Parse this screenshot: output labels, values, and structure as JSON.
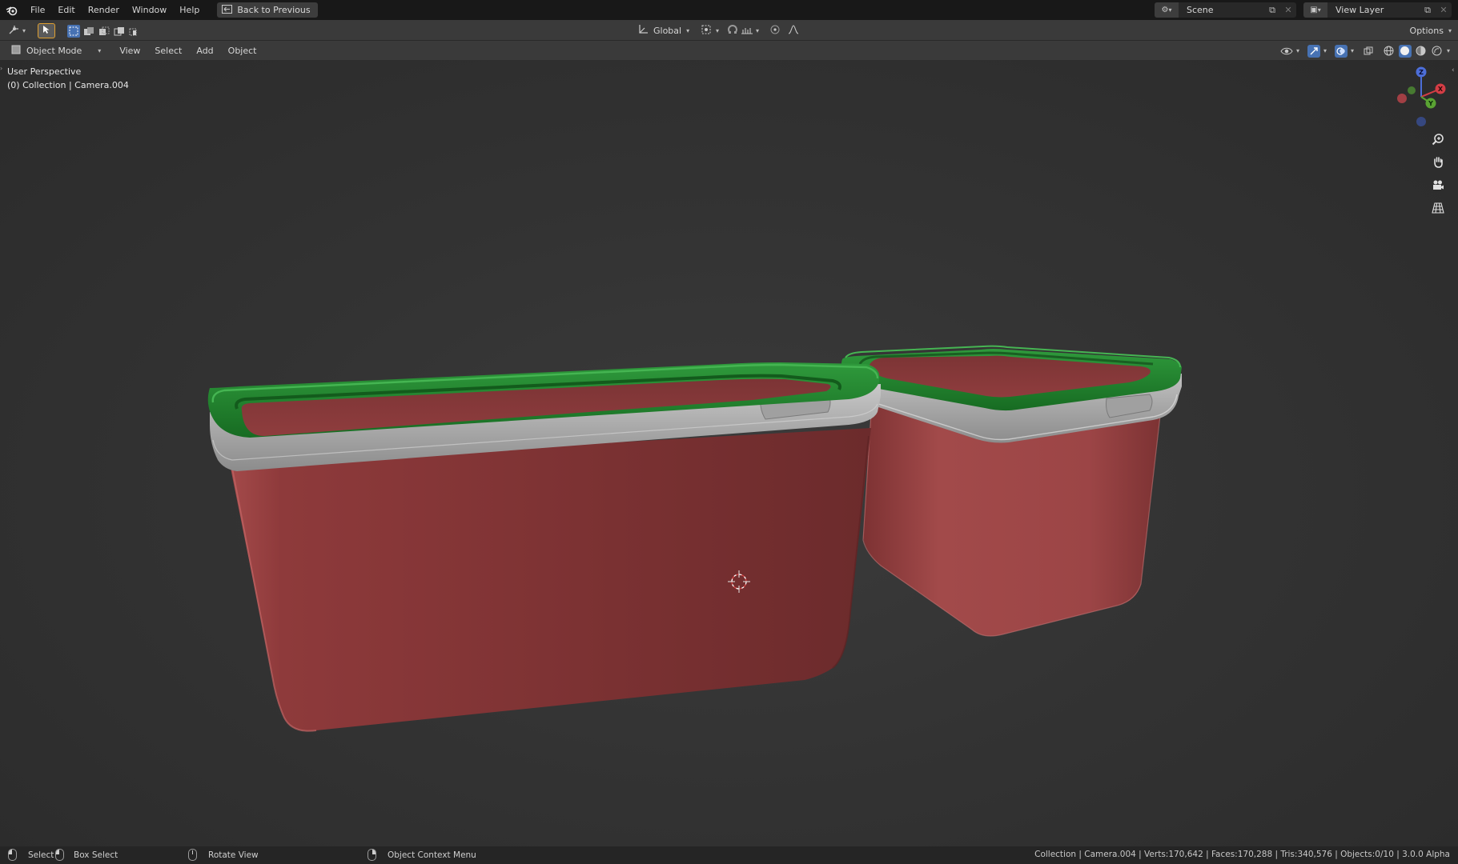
{
  "menu": {
    "file": "File",
    "edit": "Edit",
    "render": "Render",
    "window": "Window",
    "help": "Help",
    "back_to_previous": "Back to Previous"
  },
  "scene": {
    "label": "Scene"
  },
  "view_layer": {
    "label": "View Layer"
  },
  "tool_settings": {
    "orientation": "Global",
    "options": "Options"
  },
  "header": {
    "mode": "Object Mode",
    "view": "View",
    "select": "Select",
    "add": "Add",
    "object": "Object"
  },
  "viewport": {
    "perspective": "User Perspective",
    "collection_info": "(0) Collection | Camera.004",
    "gizmo_axes": {
      "x": "X",
      "y": "Y",
      "z": "Z"
    }
  },
  "statusbar": {
    "select": "Select",
    "box_select": "Box Select",
    "rotate_view": "Rotate View",
    "context_menu": "Object Context Menu",
    "stats": "Collection | Camera.004 | Verts:170,642 | Faces:170,288 | Tris:340,576 | Objects:0/10 | 3.0.0 Alpha"
  },
  "colors": {
    "container_red": "#8f3b3c",
    "container_red_dark": "#6e2c2d",
    "band_gray": "#a8a8a8",
    "lid_green": "#1f7a2a",
    "axis_x": "#d43d45",
    "axis_y": "#5aa333",
    "axis_z": "#4c6ed8",
    "accent_blue": "#4772b3"
  }
}
